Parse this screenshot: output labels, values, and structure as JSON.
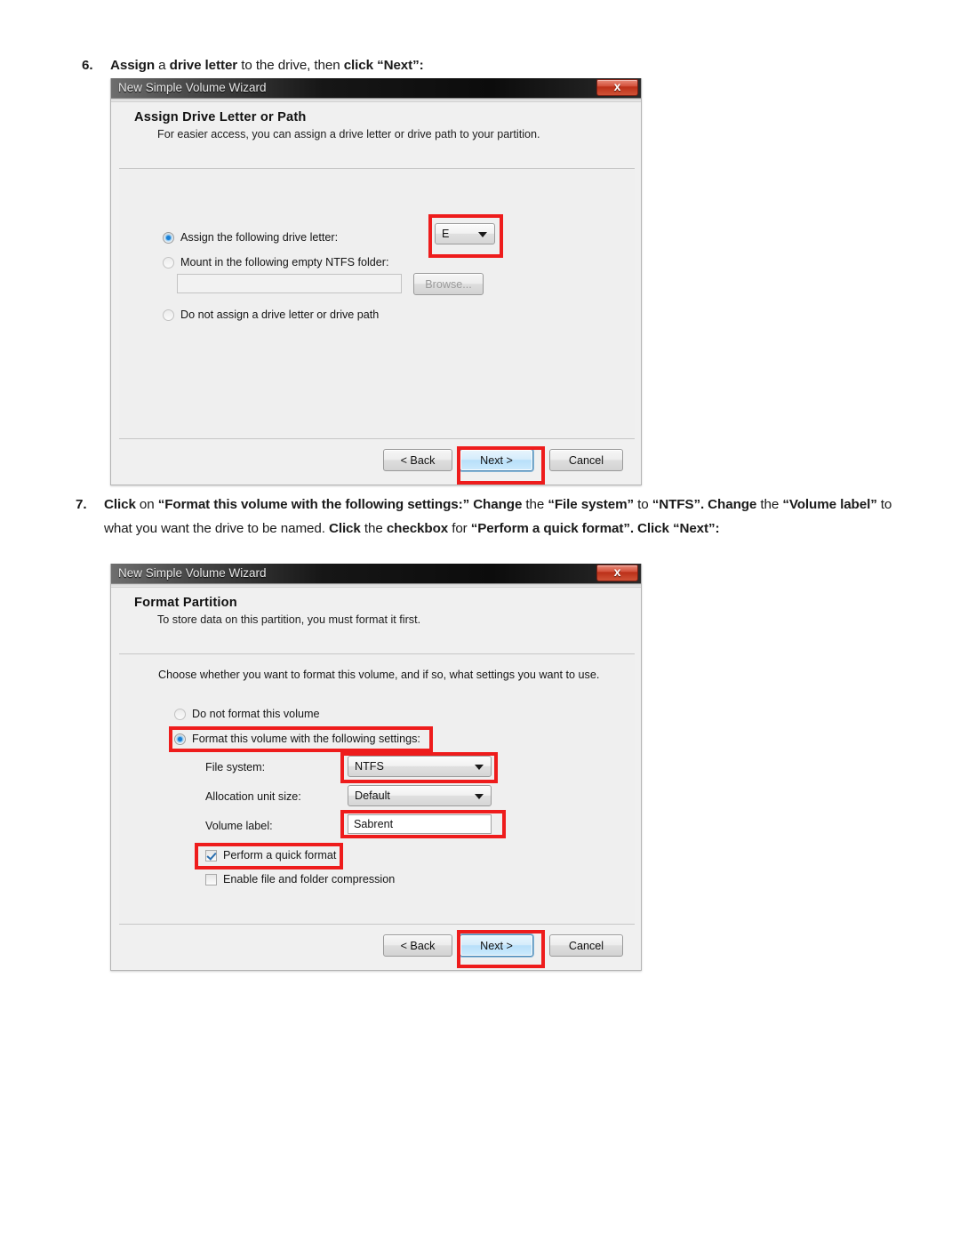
{
  "document": {
    "step6": {
      "number": "6.",
      "segments": [
        {
          "text": "Assign",
          "bold": true
        },
        {
          "text": " a ",
          "bold": false
        },
        {
          "text": "drive letter",
          "bold": true
        },
        {
          "text": " to the drive, then ",
          "bold": false
        },
        {
          "text": "click “Next”:",
          "bold": true
        }
      ]
    },
    "step7": {
      "number": "7.",
      "segments": [
        {
          "text": "Click",
          "bold": true
        },
        {
          "text": " on ",
          "bold": false
        },
        {
          "text": "“Format this volume with the following settings:” Change",
          "bold": true
        },
        {
          "text": " the ",
          "bold": false
        },
        {
          "text": "“File system”",
          "bold": true
        },
        {
          "text": " to ",
          "bold": false
        },
        {
          "text": "“NTFS”. Change",
          "bold": true
        },
        {
          "text": " the ",
          "bold": false
        },
        {
          "text": "“Volume label”",
          "bold": true
        },
        {
          "text": " to what you want the drive to be named. ",
          "bold": false
        },
        {
          "text": "Click",
          "bold": true
        },
        {
          "text": " the ",
          "bold": false
        },
        {
          "text": "checkbox",
          "bold": true
        },
        {
          "text": " for ",
          "bold": false
        },
        {
          "text": "“Perform a quick format”. Click “Next”:",
          "bold": true
        }
      ]
    }
  },
  "wizard1": {
    "title": "New Simple Volume Wizard",
    "close_label": "x",
    "heading": "Assign Drive Letter or Path",
    "subheading": "For easier access, you can assign a drive letter or drive path to your partition.",
    "options": {
      "assign_letter": "Assign the following drive letter:",
      "mount_folder": "Mount in the following empty NTFS folder:",
      "no_letter": "Do not assign a drive letter or drive path"
    },
    "drive_letter_value": "E",
    "mount_path_value": "",
    "browse_label": "Browse...",
    "buttons": {
      "back": "< Back",
      "next": "Next >",
      "cancel": "Cancel"
    }
  },
  "wizard2": {
    "title": "New Simple Volume Wizard",
    "close_label": "x",
    "heading": "Format Partition",
    "subheading": "To store data on this partition, you must format it first.",
    "intro": "Choose whether you want to format this volume, and if so, what settings you want to use.",
    "options": {
      "do_not_format": "Do not format this volume",
      "format_with_settings": "Format this volume with the following settings:"
    },
    "fields": {
      "file_system_label": "File system:",
      "file_system_value": "NTFS",
      "allocation_label": "Allocation unit size:",
      "allocation_value": "Default",
      "volume_label_label": "Volume label:",
      "volume_label_value": "Sabrent"
    },
    "checkboxes": {
      "quick_format": "Perform a quick format",
      "compression": "Enable file and folder compression"
    },
    "buttons": {
      "back": "< Back",
      "next": "Next >",
      "cancel": "Cancel"
    }
  },
  "annotations": {
    "accent_color": "#ee1c1c",
    "highlights": [
      "drive-letter-combo",
      "wizard1-next-button",
      "format-radio",
      "file-system-combo",
      "volume-label-field",
      "quick-format-checkbox",
      "wizard2-next-button"
    ]
  }
}
